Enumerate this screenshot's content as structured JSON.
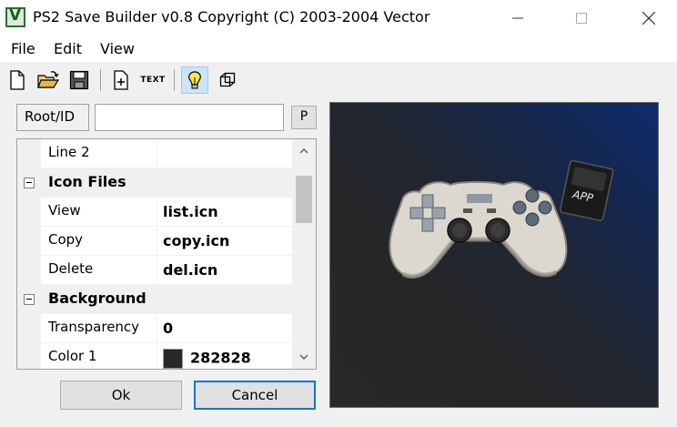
{
  "window": {
    "title": "PS2 Save Builder v0.8 Copyright (C) 2003-2004 Vector",
    "app_icon_glyph": "V"
  },
  "menu": [
    "File",
    "Edit",
    "View"
  ],
  "toolbar": {
    "icons": [
      "new-file-icon",
      "open-folder-icon",
      "save-disk-icon",
      "new-item-icon",
      "text-icon",
      "lightbulb-icon",
      "cube-icon"
    ],
    "text_button_label": "TEXT",
    "active_button": "lightbulb-icon"
  },
  "root": {
    "label": "Root/ID",
    "value": "",
    "p_button": "P"
  },
  "properties": {
    "line2": {
      "name": "Line 2",
      "value": ""
    },
    "icon_files": {
      "category": "Icon Files",
      "view": {
        "name": "View",
        "value": "list.icn"
      },
      "copy": {
        "name": "Copy",
        "value": "copy.icn"
      },
      "delete": {
        "name": "Delete",
        "value": "del.icn"
      }
    },
    "background": {
      "category": "Background",
      "transparency": {
        "name": "Transparency",
        "value": "0"
      },
      "color1": {
        "name": "Color 1",
        "value": "282828",
        "swatch": "#282828"
      }
    }
  },
  "buttons": {
    "ok": "Ok",
    "cancel": "Cancel"
  },
  "preview": {
    "card_text": "APP",
    "gradient_colors": [
      "#0f2c6e",
      "#282828"
    ]
  },
  "colors": {
    "accent": "#0078d7",
    "window_bg": "#f0f0f0",
    "active_tool_bg": "#cce4f7"
  }
}
